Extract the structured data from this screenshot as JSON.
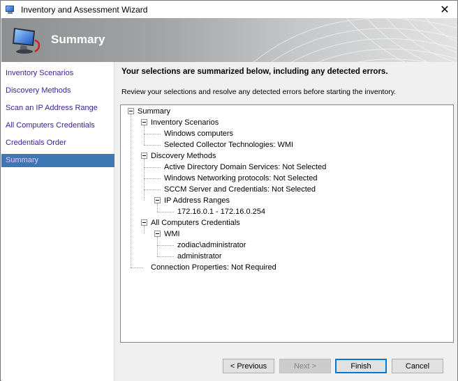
{
  "window": {
    "title": "Inventory and Assessment Wizard",
    "close_glyph": "✕"
  },
  "banner": {
    "title": "Summary",
    "icon": "computer-monitor-icon"
  },
  "nav": {
    "items": [
      {
        "label": "Inventory Scenarios",
        "active": false
      },
      {
        "label": "Discovery Methods",
        "active": false
      },
      {
        "label": "Scan an IP Address Range",
        "active": false
      },
      {
        "label": "All Computers Credentials",
        "active": false
      },
      {
        "label": "Credentials Order",
        "active": false
      },
      {
        "label": "Summary",
        "active": true
      }
    ]
  },
  "content": {
    "heading": "Your selections are summarized below, including any detected errors.",
    "subheading": "Review your selections and resolve any detected errors before starting the inventory."
  },
  "tree": {
    "root": "Summary",
    "inventory_scenarios": "Inventory Scenarios",
    "windows_computers": "Windows computers",
    "collector_tech": "Selected Collector Technologies: WMI",
    "discovery_methods": "Discovery Methods",
    "ad_services": "Active Directory Domain Services: Not Selected",
    "windows_networking": "Windows Networking protocols: Not Selected",
    "sccm": "SCCM Server and Credentials: Not Selected",
    "ip_ranges": "IP Address Ranges",
    "ip_range_1": "172.16.0.1 - 172.16.0.254",
    "all_credentials": "All Computers Credentials",
    "wmi": "WMI",
    "cred_1": "zodiac\\administrator",
    "cred_2": "administrator",
    "connection_props": "Connection Properties: Not Required"
  },
  "buttons": {
    "previous": "< Previous",
    "next": "Next >",
    "finish": "Finish",
    "cancel": "Cancel"
  },
  "colors": {
    "nav_link": "#3b1f8f",
    "nav_active_bg": "#3d78b4",
    "nav_active_text": "#e6c7ff",
    "default_button_border": "#0078d7"
  }
}
